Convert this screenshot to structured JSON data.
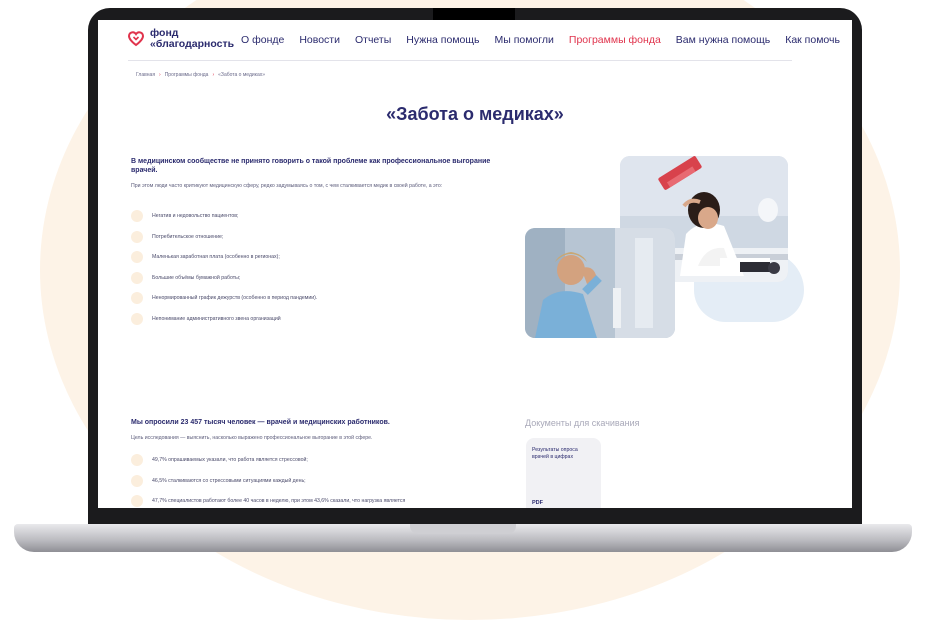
{
  "logo": {
    "line1": "фонд",
    "line2": "«благодарность"
  },
  "nav": [
    {
      "label": "О фонде",
      "active": false
    },
    {
      "label": "Новости",
      "active": false
    },
    {
      "label": "Отчеты",
      "active": false
    },
    {
      "label": "Нужна помощь",
      "active": false
    },
    {
      "label": "Мы помогли",
      "active": false
    },
    {
      "label": "Программы фонда",
      "active": true
    },
    {
      "label": "Вам нужна помощь",
      "active": false
    },
    {
      "label": "Как помочь",
      "active": false
    }
  ],
  "breadcrumb": [
    "Главная",
    "Программы фонда",
    "«Забота о медиках»"
  ],
  "page_title": "«Забота о медиках»",
  "section1": {
    "heading": "В медицинском сообществе не принято говорить о такой проблеме как профессиональное выгорание врачей.",
    "intro": "При этом люди часто критикуют медицинскую сферу, редко задумываясь о том, с чем сталкивается медик в своей работе, а это:",
    "bullets": [
      "Негатив и недовольство пациентов;",
      "Потребительское отношение;",
      "Маленькая заработная плата (особенно в регионах);",
      "Большие объёмы бумажной работы;",
      "Ненормированный график дежурств (особенно в период пандемии).",
      "Непонимание административного звена организаций"
    ]
  },
  "section2": {
    "heading": "Мы опросили 23 457 тысяч человек — врачей и медицинских работников.",
    "intro": "Цель исследования — выяснить, насколько выражено профессиональное выгорание в этой сфере.",
    "bullets": [
      "49,7% опрашиваемых указали, что работа является стрессовой;",
      "46,5% сталкиваются со стрессовыми ситуациями каждый день;",
      "47,7% специалистов работают более 40 часов в неделю, при этом 43,6% сказали, что нагрузка является"
    ]
  },
  "documents": {
    "title": "Документы для скачивания",
    "items": [
      {
        "title": "Результаты опроса врачей в цифрах",
        "type": "PDF"
      }
    ]
  },
  "colors": {
    "brand_navy": "#2b2b6e",
    "accent_red": "#e0334c",
    "bullet_peach": "#fbeedd",
    "background_peach": "#fdf3e7"
  }
}
